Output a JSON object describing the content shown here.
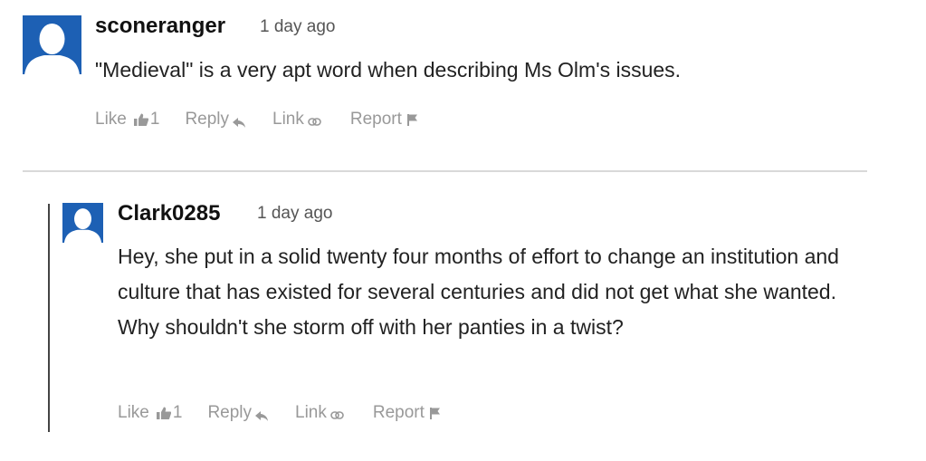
{
  "comments": [
    {
      "author": "sconeranger",
      "time": "1 day ago",
      "text": "\"Medieval\" is a very apt word when describing Ms Olm's issues.",
      "actions": {
        "like_label": "Like",
        "like_count": "1",
        "reply_label": "Reply",
        "link_label": "Link",
        "report_label": "Report"
      }
    },
    {
      "author": "Clark0285",
      "time": "1 day ago",
      "text": "Hey, she put in a solid twenty four months of effort to change an institution and culture that has existed for several centuries and did not get what she wanted. Why shouldn't she storm off with her panties in a twist?",
      "actions": {
        "like_label": "Like",
        "like_count": "1",
        "reply_label": "Reply",
        "link_label": "Link",
        "report_label": "Report"
      }
    }
  ],
  "colors": {
    "avatar": "#1d60b4",
    "action_text": "#999999",
    "divider": "#d9d9d9",
    "thread_line": "#444444"
  },
  "icons": {
    "avatar": "user-silhouette-icon",
    "like": "thumbs-up-icon",
    "reply": "reply-arrow-icon",
    "link": "chain-link-icon",
    "report": "flag-icon"
  }
}
